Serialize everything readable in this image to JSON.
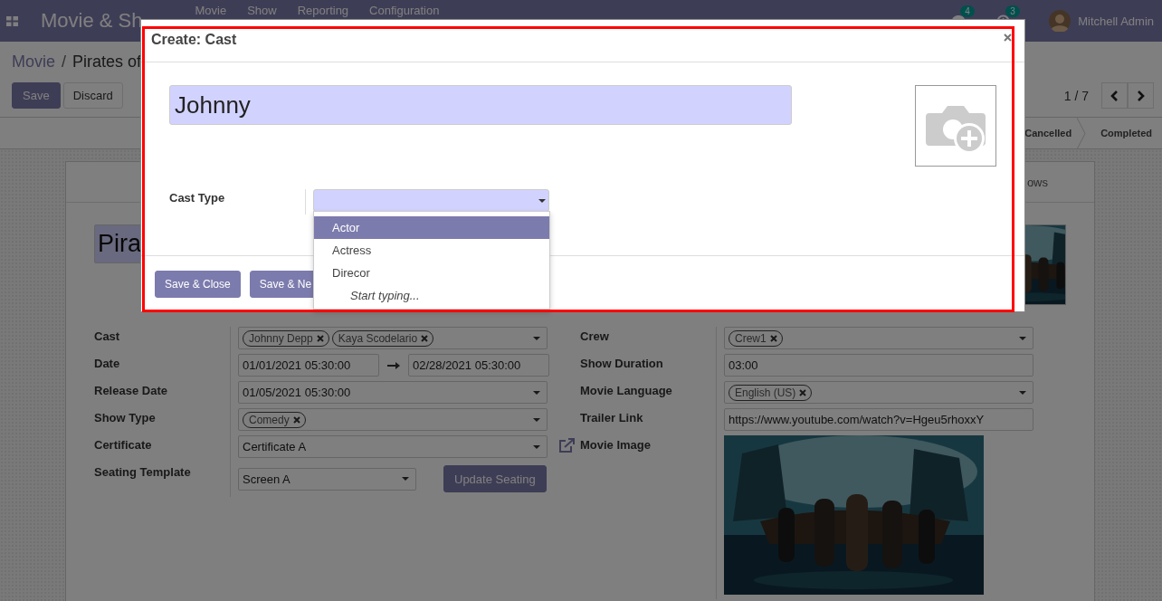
{
  "navbar": {
    "brand": "Movie & Sh",
    "menus": [
      "Movie",
      "Show",
      "Reporting",
      "Configuration"
    ],
    "messages_badge": "4",
    "activities_badge": "3",
    "user": "Mitchell Admin"
  },
  "control_panel": {
    "breadcrumb": [
      "Movie",
      "/",
      "Pirates of"
    ],
    "buttons": [
      "Save",
      "Discard"
    ],
    "pager": "1 / 7"
  },
  "statusbar": [
    {
      "label": "Cancelled",
      "selected": false
    },
    {
      "label": "Completed",
      "selected": false
    }
  ],
  "sheet": {
    "tabs": [
      {
        "label": "ows",
        "selected": false
      }
    ],
    "title": "Pira",
    "left_fields": [
      {
        "label": "Cast",
        "kind": "tags",
        "tags": [
          "Johnny Depp",
          "Kaya Scodelario"
        ]
      },
      {
        "label": "Date",
        "kind": "daterange",
        "values": [
          "01/01/2021 05:30:00",
          "02/28/2021 05:30:00"
        ]
      },
      {
        "label": "Release Date",
        "kind": "select",
        "value": "01/05/2021 05:30:00"
      },
      {
        "label": "Show Type",
        "kind": "tags",
        "tags": [
          "Comedy"
        ]
      },
      {
        "label": "Certificate",
        "kind": "select",
        "value": "Certificate A"
      },
      {
        "label": "Seating Template",
        "kind": "select_button",
        "value": "Screen A",
        "button": "Update Seating"
      }
    ],
    "right_fields": [
      {
        "label": "Crew",
        "kind": "tags",
        "tags": [
          "Crew1"
        ]
      },
      {
        "label": "Show Duration",
        "kind": "text",
        "value": "03:00"
      },
      {
        "label": "Movie Language",
        "kind": "tags",
        "tags": [
          "English (US)"
        ]
      },
      {
        "label": "Trailer Link",
        "kind": "text",
        "value": "https://www.youtube.com/watch?v=Hgeu5rhoxxY"
      },
      {
        "label": "Movie Image"
      }
    ]
  },
  "dialog": {
    "title": "Create: Cast",
    "name": "Johnny",
    "cast_type_label": "Cast Type",
    "options": [
      {
        "label": "Actor",
        "selected": true
      },
      {
        "label": "Actress",
        "selected": false
      },
      {
        "label": "Direcor",
        "selected": false
      }
    ],
    "search_more": "Start typing...",
    "buttons": [
      "Save & Close",
      "Save & Ne"
    ]
  }
}
